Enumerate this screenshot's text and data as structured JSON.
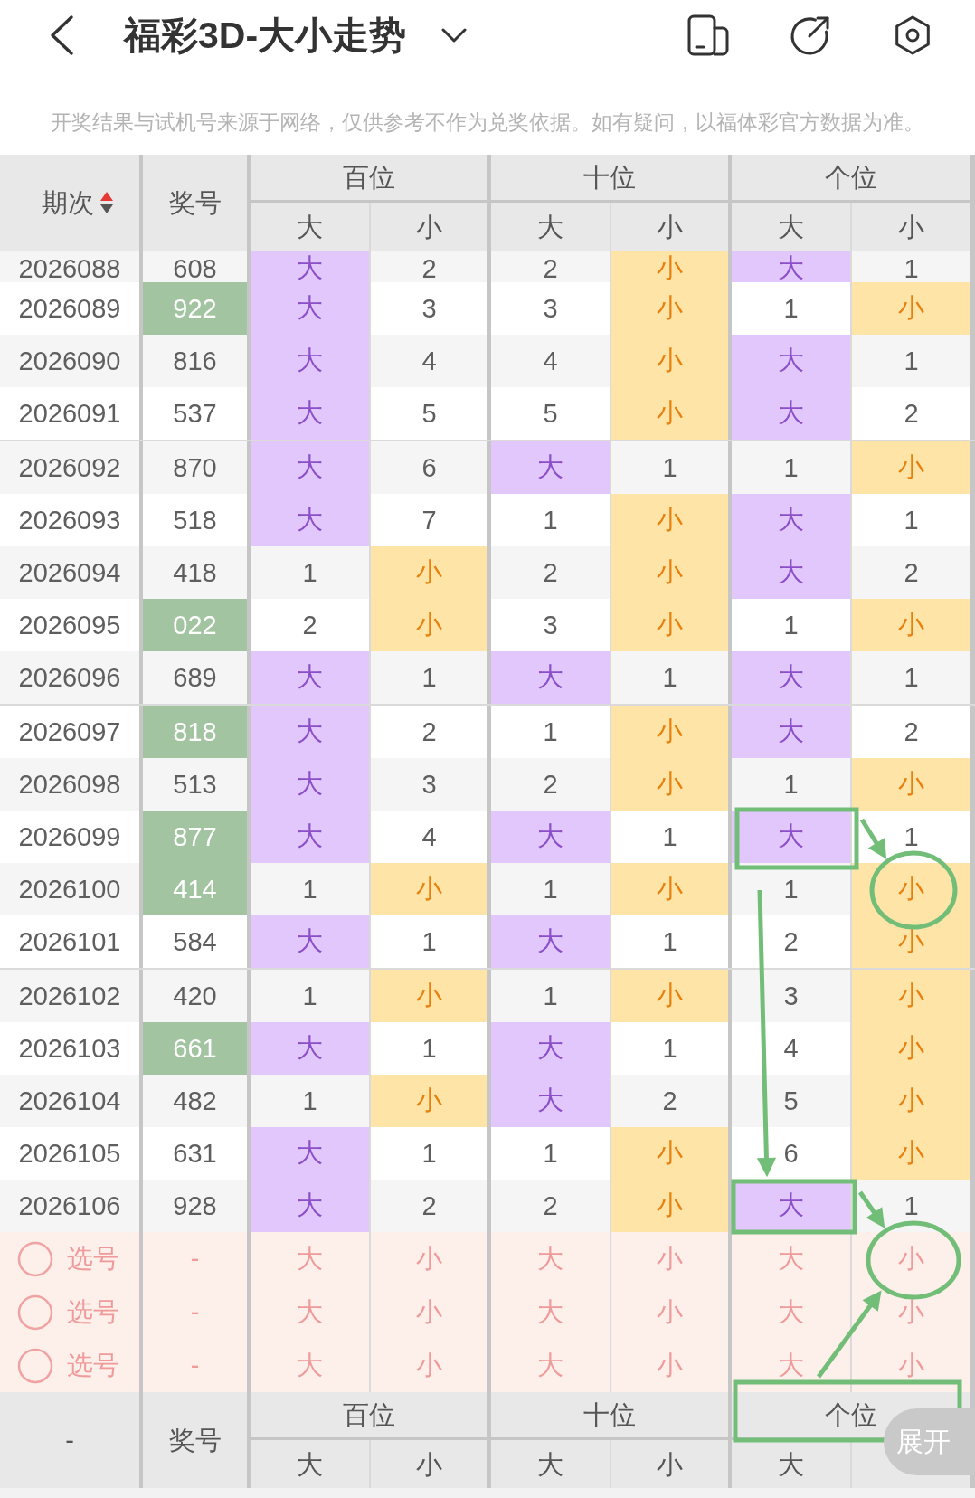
{
  "topbar": {
    "title": "福彩3D-大小走势"
  },
  "notice": "开奖结果与试机号来源于网络，仅供参考不作为兑奖依据。如有疑问，以福体彩官方数据为准。",
  "table": {
    "header": {
      "period": "期次",
      "sort_ascending": true,
      "number": "奖号",
      "positions": [
        {
          "label": "百位",
          "subs": [
            "大",
            "小"
          ]
        },
        {
          "label": "十位",
          "subs": [
            "大",
            "小"
          ]
        },
        {
          "label": "个位",
          "subs": [
            "大",
            "小"
          ]
        }
      ]
    },
    "groups": [
      {
        "rows": [
          {
            "period": "2026088",
            "number": "608",
            "highlighted": false,
            "clipped": true,
            "cells": [
              {
                "text": "大",
                "hit": true
              },
              {
                "text": "2",
                "hit": false
              },
              {
                "text": "2",
                "hit": false
              },
              {
                "text": "小",
                "hit": true
              },
              {
                "text": "大",
                "hit": true
              },
              {
                "text": "1",
                "hit": false
              }
            ]
          },
          {
            "period": "2026089",
            "number": "922",
            "highlighted": true,
            "clipped": false,
            "cells": [
              {
                "text": "大",
                "hit": true
              },
              {
                "text": "3",
                "hit": false
              },
              {
                "text": "3",
                "hit": false
              },
              {
                "text": "小",
                "hit": true
              },
              {
                "text": "1",
                "hit": false
              },
              {
                "text": "小",
                "hit": true
              }
            ]
          },
          {
            "period": "2026090",
            "number": "816",
            "highlighted": false,
            "clipped": false,
            "cells": [
              {
                "text": "大",
                "hit": true
              },
              {
                "text": "4",
                "hit": false
              },
              {
                "text": "4",
                "hit": false
              },
              {
                "text": "小",
                "hit": true
              },
              {
                "text": "大",
                "hit": true
              },
              {
                "text": "1",
                "hit": false
              }
            ]
          },
          {
            "period": "2026091",
            "number": "537",
            "highlighted": false,
            "clipped": false,
            "cells": [
              {
                "text": "大",
                "hit": true
              },
              {
                "text": "5",
                "hit": false
              },
              {
                "text": "5",
                "hit": false
              },
              {
                "text": "小",
                "hit": true
              },
              {
                "text": "大",
                "hit": true
              },
              {
                "text": "2",
                "hit": false
              }
            ]
          }
        ]
      },
      {
        "rows": [
          {
            "period": "2026092",
            "number": "870",
            "highlighted": false,
            "clipped": false,
            "cells": [
              {
                "text": "大",
                "hit": true
              },
              {
                "text": "6",
                "hit": false
              },
              {
                "text": "大",
                "hit": true
              },
              {
                "text": "1",
                "hit": false
              },
              {
                "text": "1",
                "hit": false
              },
              {
                "text": "小",
                "hit": true
              }
            ]
          },
          {
            "period": "2026093",
            "number": "518",
            "highlighted": false,
            "clipped": false,
            "cells": [
              {
                "text": "大",
                "hit": true
              },
              {
                "text": "7",
                "hit": false
              },
              {
                "text": "1",
                "hit": false
              },
              {
                "text": "小",
                "hit": true
              },
              {
                "text": "大",
                "hit": true
              },
              {
                "text": "1",
                "hit": false
              }
            ]
          },
          {
            "period": "2026094",
            "number": "418",
            "highlighted": false,
            "clipped": false,
            "cells": [
              {
                "text": "1",
                "hit": false
              },
              {
                "text": "小",
                "hit": true
              },
              {
                "text": "2",
                "hit": false
              },
              {
                "text": "小",
                "hit": true
              },
              {
                "text": "大",
                "hit": true
              },
              {
                "text": "2",
                "hit": false
              }
            ]
          },
          {
            "period": "2026095",
            "number": "022",
            "highlighted": true,
            "clipped": false,
            "cells": [
              {
                "text": "2",
                "hit": false
              },
              {
                "text": "小",
                "hit": true
              },
              {
                "text": "3",
                "hit": false
              },
              {
                "text": "小",
                "hit": true
              },
              {
                "text": "1",
                "hit": false
              },
              {
                "text": "小",
                "hit": true
              }
            ]
          },
          {
            "period": "2026096",
            "number": "689",
            "highlighted": false,
            "clipped": false,
            "cells": [
              {
                "text": "大",
                "hit": true
              },
              {
                "text": "1",
                "hit": false
              },
              {
                "text": "大",
                "hit": true
              },
              {
                "text": "1",
                "hit": false
              },
              {
                "text": "大",
                "hit": true
              },
              {
                "text": "1",
                "hit": false
              }
            ]
          }
        ]
      },
      {
        "rows": [
          {
            "period": "2026097",
            "number": "818",
            "highlighted": true,
            "clipped": false,
            "cells": [
              {
                "text": "大",
                "hit": true
              },
              {
                "text": "2",
                "hit": false
              },
              {
                "text": "1",
                "hit": false
              },
              {
                "text": "小",
                "hit": true
              },
              {
                "text": "大",
                "hit": true
              },
              {
                "text": "2",
                "hit": false
              }
            ]
          },
          {
            "period": "2026098",
            "number": "513",
            "highlighted": false,
            "clipped": false,
            "cells": [
              {
                "text": "大",
                "hit": true
              },
              {
                "text": "3",
                "hit": false
              },
              {
                "text": "2",
                "hit": false
              },
              {
                "text": "小",
                "hit": true
              },
              {
                "text": "1",
                "hit": false
              },
              {
                "text": "小",
                "hit": true
              }
            ]
          },
          {
            "period": "2026099",
            "number": "877",
            "highlighted": true,
            "clipped": false,
            "cells": [
              {
                "text": "大",
                "hit": true
              },
              {
                "text": "4",
                "hit": false
              },
              {
                "text": "大",
                "hit": true
              },
              {
                "text": "1",
                "hit": false
              },
              {
                "text": "大",
                "hit": true
              },
              {
                "text": "1",
                "hit": false
              }
            ]
          },
          {
            "period": "2026100",
            "number": "414",
            "highlighted": true,
            "clipped": false,
            "cells": [
              {
                "text": "1",
                "hit": false
              },
              {
                "text": "小",
                "hit": true
              },
              {
                "text": "1",
                "hit": false
              },
              {
                "text": "小",
                "hit": true
              },
              {
                "text": "1",
                "hit": false
              },
              {
                "text": "小",
                "hit": true
              }
            ]
          },
          {
            "period": "2026101",
            "number": "584",
            "highlighted": false,
            "clipped": false,
            "cells": [
              {
                "text": "大",
                "hit": true
              },
              {
                "text": "1",
                "hit": false
              },
              {
                "text": "大",
                "hit": true
              },
              {
                "text": "1",
                "hit": false
              },
              {
                "text": "2",
                "hit": false
              },
              {
                "text": "小",
                "hit": true
              }
            ]
          }
        ]
      },
      {
        "rows": [
          {
            "period": "2026102",
            "number": "420",
            "highlighted": false,
            "clipped": false,
            "cells": [
              {
                "text": "1",
                "hit": false
              },
              {
                "text": "小",
                "hit": true
              },
              {
                "text": "1",
                "hit": false
              },
              {
                "text": "小",
                "hit": true
              },
              {
                "text": "3",
                "hit": false
              },
              {
                "text": "小",
                "hit": true
              }
            ]
          },
          {
            "period": "2026103",
            "number": "661",
            "highlighted": true,
            "clipped": false,
            "cells": [
              {
                "text": "大",
                "hit": true
              },
              {
                "text": "1",
                "hit": false
              },
              {
                "text": "大",
                "hit": true
              },
              {
                "text": "1",
                "hit": false
              },
              {
                "text": "4",
                "hit": false
              },
              {
                "text": "小",
                "hit": true
              }
            ]
          },
          {
            "period": "2026104",
            "number": "482",
            "highlighted": false,
            "clipped": false,
            "cells": [
              {
                "text": "1",
                "hit": false
              },
              {
                "text": "小",
                "hit": true
              },
              {
                "text": "大",
                "hit": true
              },
              {
                "text": "2",
                "hit": false
              },
              {
                "text": "5",
                "hit": false
              },
              {
                "text": "小",
                "hit": true
              }
            ]
          },
          {
            "period": "2026105",
            "number": "631",
            "highlighted": false,
            "clipped": false,
            "cells": [
              {
                "text": "大",
                "hit": true
              },
              {
                "text": "1",
                "hit": false
              },
              {
                "text": "1",
                "hit": false
              },
              {
                "text": "小",
                "hit": true
              },
              {
                "text": "6",
                "hit": false
              },
              {
                "text": "小",
                "hit": true
              }
            ]
          },
          {
            "period": "2026106",
            "number": "928",
            "highlighted": false,
            "clipped": false,
            "cells": [
              {
                "text": "大",
                "hit": true
              },
              {
                "text": "2",
                "hit": false
              },
              {
                "text": "2",
                "hit": false
              },
              {
                "text": "小",
                "hit": true
              },
              {
                "text": "大",
                "hit": true
              },
              {
                "text": "1",
                "hit": false
              }
            ]
          }
        ]
      }
    ],
    "pick_rows": [
      {
        "label": "选号",
        "selected": false,
        "number": "-",
        "options": [
          {
            "text": "大",
            "selected": false
          },
          {
            "text": "小",
            "selected": false
          },
          {
            "text": "大",
            "selected": false
          },
          {
            "text": "小",
            "selected": false
          },
          {
            "text": "大",
            "selected": false
          },
          {
            "text": "小",
            "selected": false
          }
        ]
      },
      {
        "label": "选号",
        "selected": false,
        "number": "-",
        "options": [
          {
            "text": "大",
            "selected": false
          },
          {
            "text": "小",
            "selected": false
          },
          {
            "text": "大",
            "selected": false
          },
          {
            "text": "小",
            "selected": false
          },
          {
            "text": "大",
            "selected": false
          },
          {
            "text": "小",
            "selected": false
          }
        ]
      },
      {
        "label": "选号",
        "selected": false,
        "number": "-",
        "options": [
          {
            "text": "大",
            "selected": false
          },
          {
            "text": "小",
            "selected": false
          },
          {
            "text": "大",
            "selected": false
          },
          {
            "text": "小",
            "selected": false
          },
          {
            "text": "大",
            "selected": false
          },
          {
            "text": "小",
            "selected": false
          }
        ]
      }
    ],
    "footer": {
      "period": "-",
      "number": "奖号",
      "positions": [
        {
          "label": "百位",
          "subs": [
            "大",
            "小"
          ]
        },
        {
          "label": "十位",
          "subs": [
            "大",
            "小"
          ]
        },
        {
          "label": "个位",
          "subs": [
            "大"
          ]
        }
      ]
    }
  },
  "expand_button": "展开"
}
